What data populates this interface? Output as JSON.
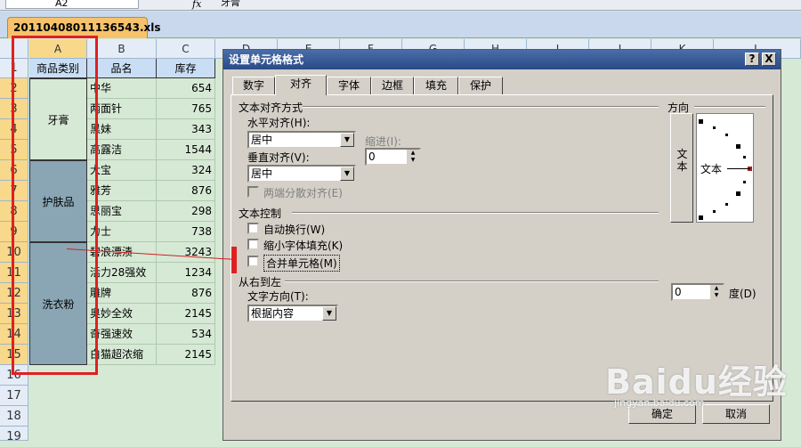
{
  "formula_bar": {
    "cell_ref": "A2",
    "fx": "fx",
    "content": "牙膏"
  },
  "file_tab": "20110408011136543.xls",
  "columns": [
    "A",
    "B",
    "C",
    "D",
    "E",
    "F",
    "G",
    "H",
    "I",
    "J",
    "K",
    "L"
  ],
  "rows": [
    "1",
    "2",
    "3",
    "4",
    "5",
    "6",
    "7",
    "8",
    "9",
    "10",
    "11",
    "12",
    "13",
    "14",
    "15",
    "16",
    "17",
    "18",
    "19"
  ],
  "table": {
    "headers": [
      "商品类别",
      "品名",
      "库存"
    ],
    "categories": [
      "牙膏",
      "护肤品",
      "洗衣粉"
    ],
    "items": [
      {
        "name": "中华",
        "stock": "654"
      },
      {
        "name": "两面针",
        "stock": "765"
      },
      {
        "name": "黑妹",
        "stock": "343"
      },
      {
        "name": "高露洁",
        "stock": "1544"
      },
      {
        "name": "大宝",
        "stock": "324"
      },
      {
        "name": "雅芳",
        "stock": "876"
      },
      {
        "name": "思丽宝",
        "stock": "298"
      },
      {
        "name": "力士",
        "stock": "738"
      },
      {
        "name": "碧浪漂渍",
        "stock": "3243"
      },
      {
        "name": "活力28强效",
        "stock": "1234"
      },
      {
        "name": "雕牌",
        "stock": "876"
      },
      {
        "name": "奥妙全效",
        "stock": "2145"
      },
      {
        "name": "奇强速效",
        "stock": "534"
      },
      {
        "name": "白猫超浓缩",
        "stock": "2145"
      }
    ]
  },
  "dialog": {
    "title": "设置单元格格式",
    "help_btn": "?",
    "close_btn": "X",
    "tabs": [
      "数字",
      "对齐",
      "字体",
      "边框",
      "填充",
      "保护"
    ],
    "active_tab": "对齐",
    "text_align_section": "文本对齐方式",
    "horizontal_label": "水平对齐(H):",
    "horizontal_value": "居中",
    "indent_label": "缩进(I):",
    "indent_value": "0",
    "vertical_label": "垂直对齐(V):",
    "vertical_value": "居中",
    "distributed_label": "两端分散对齐(E)",
    "text_control_section": "文本控制",
    "wrap_label": "自动换行(W)",
    "shrink_label": "缩小字体填充(K)",
    "merge_label": "合并单元格(M)",
    "rtl_section": "从右到左",
    "direction_label": "文字方向(T):",
    "direction_value": "根据内容",
    "orientation_section": "方向",
    "vertical_text": "文本",
    "dial_text": "文本",
    "degrees_value": "0",
    "degrees_label": "度(D)",
    "ok_btn": "确定",
    "cancel_btn": "取消"
  },
  "watermark": {
    "brand": "Baidu经验",
    "url": "jingyan.baidu.com"
  }
}
